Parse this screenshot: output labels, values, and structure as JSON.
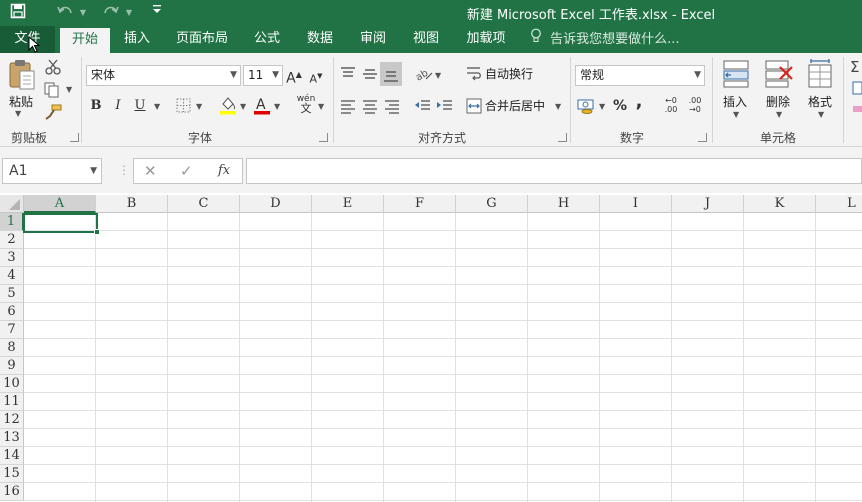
{
  "titlebar": {
    "title": "新建 Microsoft Excel 工作表.xlsx - Excel",
    "save_icon": "save-icon",
    "undo_icon": "undo-icon",
    "redo_icon": "redo-icon",
    "customize_icon": "customize-qat-icon"
  },
  "tabs": {
    "file": "文件",
    "home": "开始",
    "insert": "插入",
    "page_layout": "页面布局",
    "formulas": "公式",
    "data": "数据",
    "review": "审阅",
    "view": "视图",
    "addins": "加载项",
    "tell_me": "告诉我您想要做什么..."
  },
  "ribbon": {
    "clipboard": {
      "label": "剪贴板",
      "paste": "粘贴"
    },
    "font": {
      "label": "字体",
      "name": "宋体",
      "size": "11",
      "bold": "B",
      "italic": "I",
      "underline": "U",
      "grow": "A",
      "shrink": "A",
      "phonetic": "wén"
    },
    "alignment": {
      "label": "对齐方式",
      "wrap_text": "自动换行",
      "merge_center": "合并后居中"
    },
    "number": {
      "label": "数字",
      "format": "常规",
      "percent": "%",
      "comma": ",",
      "inc_decimal": "←0 .00",
      "dec_decimal": ".00 →0"
    },
    "cells": {
      "label": "单元格",
      "insert": "插入",
      "delete": "删除",
      "format": "格式"
    }
  },
  "formula_bar": {
    "name_box": "A1",
    "cancel": "✕",
    "enter": "✓",
    "fx": "fx",
    "content": ""
  },
  "sheet": {
    "columns": [
      "A",
      "B",
      "C",
      "D",
      "E",
      "F",
      "G",
      "H",
      "I",
      "J",
      "K",
      "L"
    ],
    "rows": [
      "1",
      "2",
      "3",
      "4",
      "5",
      "6",
      "7",
      "8",
      "9",
      "10",
      "11",
      "12",
      "13",
      "14",
      "15",
      "16"
    ],
    "active_cell": "A1"
  },
  "colors": {
    "brand": "#217346",
    "brand_dark": "#185c37",
    "ribbon_bg": "#f3f3f3"
  }
}
